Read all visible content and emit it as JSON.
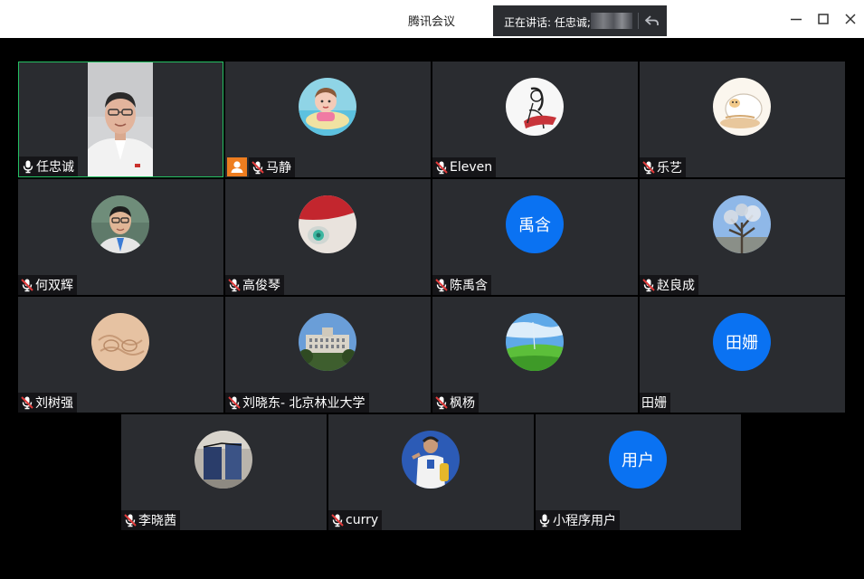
{
  "app_title": "腾讯会议",
  "speaking": {
    "prefix": "正在讲话: ",
    "name": "任忠诚;"
  },
  "colors": {
    "active_border": "#24c063",
    "avatar_blue": "#0a72f2",
    "host_badge": "#ee7d1f",
    "muted_red": "#e03b3b",
    "tile_bg": "#2a2c30"
  },
  "participants": [
    {
      "name": "任忠诚",
      "mic": "on",
      "video": true,
      "active": true
    },
    {
      "name": "马静",
      "mic": "muted",
      "avatar": "photo-child",
      "host": true
    },
    {
      "name": "Eleven",
      "mic": "muted",
      "avatar": "photo-sketch"
    },
    {
      "name": "乐艺",
      "mic": "muted",
      "avatar": "photo-cartoon"
    },
    {
      "name": "何双辉",
      "mic": "muted",
      "avatar": "photo-man"
    },
    {
      "name": "高俊琴",
      "mic": "muted",
      "avatar": "photo-red-white"
    },
    {
      "name": "陈禹含",
      "mic": "muted",
      "avatar_text": "禹含"
    },
    {
      "name": "赵良成",
      "mic": "muted",
      "avatar": "photo-tree"
    },
    {
      "name": "刘树强",
      "mic": "muted",
      "avatar": "photo-sand"
    },
    {
      "name": "刘晓东- 北京林业大学",
      "mic": "muted",
      "avatar": "photo-building"
    },
    {
      "name": "枫杨",
      "mic": "muted",
      "avatar": "photo-landscape"
    },
    {
      "name": "田姗",
      "mic": "none",
      "avatar_text": "田姗"
    },
    {
      "name": "李晓茜",
      "mic": "muted",
      "avatar": "photo-person"
    },
    {
      "name": "curry",
      "mic": "muted",
      "avatar": "photo-player"
    },
    {
      "name": "小程序用户",
      "mic": "on",
      "avatar_text": "用户"
    }
  ]
}
